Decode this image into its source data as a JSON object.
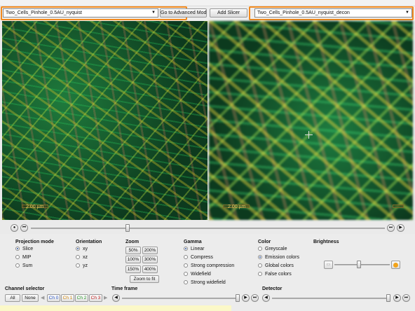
{
  "toolbar": {
    "left_select": "Two_Cells_Pinhole_0.5AU_nyquist",
    "advanced_button": "Go to Advanced Mode",
    "add_slicer_button": "Add Slicer",
    "right_select": "Two_Cells_Pinhole_0.5AU_nyquist_decon"
  },
  "views": {
    "left_scalebar": "2.00 µm",
    "right_scalebar": "2.00 µm"
  },
  "controls": {
    "projection": {
      "title": "Projection mode",
      "options": [
        "Slice",
        "MIP",
        "Sum"
      ],
      "selected": "Slice"
    },
    "orientation": {
      "title": "Orientation",
      "options": [
        "xy",
        "xz",
        "yz"
      ],
      "selected": "xy"
    },
    "zoom": {
      "title": "Zoom",
      "buttons": [
        "50%",
        "200%",
        "100%",
        "300%",
        "150%",
        "400%"
      ],
      "fit": "Zoom to fit"
    },
    "gamma": {
      "title": "Gamma",
      "options": [
        "Linear",
        "Compress",
        "Strong compression",
        "Widefield",
        "Strong widefield"
      ],
      "selected": "Linear"
    },
    "color": {
      "title": "Color",
      "options": [
        "Greyscale",
        "Emission colors",
        "Global colors",
        "False colors"
      ],
      "selected": "Emission colors"
    },
    "brightness": {
      "title": "Brightness"
    }
  },
  "bottom": {
    "channel_selector": "Channel selector",
    "all": "All",
    "none": "None",
    "channels": [
      "Ch 0",
      "Ch 1",
      "Ch 2",
      "Ch 3"
    ],
    "channel_colors": [
      "#2a55c8",
      "#d48a10",
      "#2a9a2a",
      "#c02020"
    ],
    "time_frame": "Time frame",
    "detector": "Detector"
  }
}
